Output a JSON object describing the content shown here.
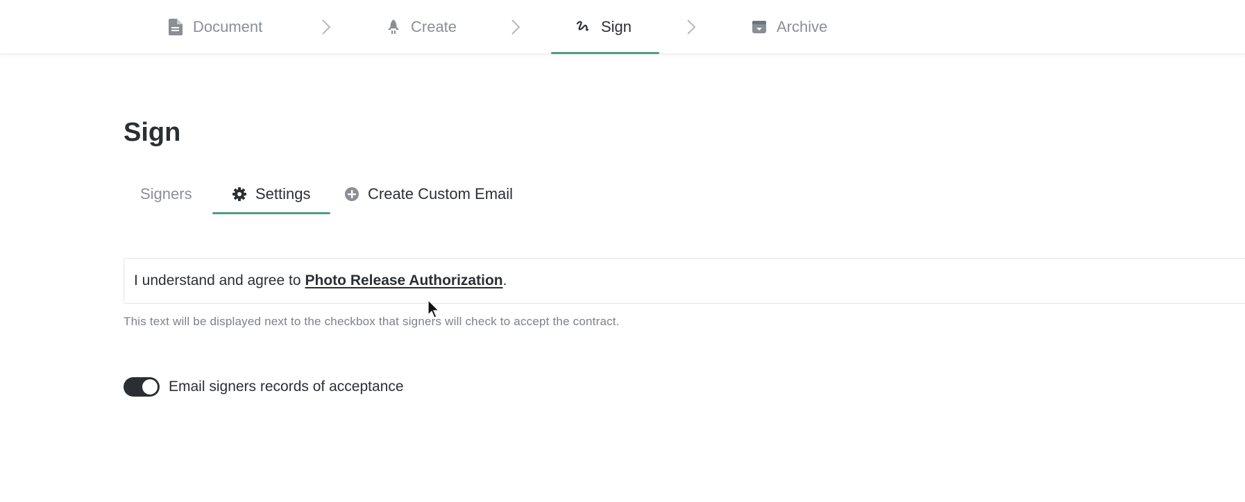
{
  "stepper": {
    "steps": [
      {
        "label": "Document",
        "icon": "document-icon",
        "active": false
      },
      {
        "label": "Create",
        "icon": "rocket-icon",
        "active": false
      },
      {
        "label": "Sign",
        "icon": "signature-icon",
        "active": true
      },
      {
        "label": "Archive",
        "icon": "archive-box-icon",
        "active": false
      }
    ],
    "accent_color": "#4d9c86"
  },
  "page": {
    "title": "Sign"
  },
  "tabs": [
    {
      "label": "Signers",
      "icon": null,
      "active": false
    },
    {
      "label": "Settings",
      "icon": "gear-icon",
      "active": true
    },
    {
      "label": "Create Custom Email",
      "icon": "plus-circle-icon",
      "active": false
    }
  ],
  "agreement": {
    "prefix": "I understand and agree to",
    "link_text": "Photo Release Authorization",
    "suffix": ".",
    "helper_text": "This text will be displayed next to the checkbox that signers will check to accept the contract."
  },
  "email_toggle": {
    "label": "Email signers records of acceptance",
    "enabled": true
  }
}
